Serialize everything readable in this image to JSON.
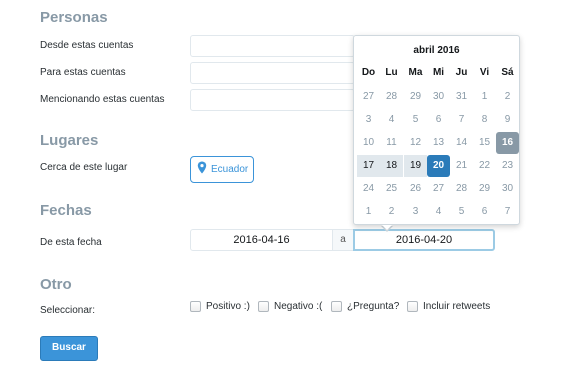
{
  "sections": {
    "personas": "Personas",
    "lugares": "Lugares",
    "fechas": "Fechas",
    "otro": "Otro"
  },
  "personas": {
    "from_label": "Desde estas cuentas",
    "to_label": "Para estas cuentas",
    "mention_label": "Mencionando estas cuentas"
  },
  "lugares": {
    "near_label": "Cerca de este lugar",
    "place_value": "Ecuador"
  },
  "fechas": {
    "date_label": "De esta fecha",
    "from_date": "2016-04-16",
    "separator": "a",
    "to_date": "2016-04-20"
  },
  "otro": {
    "select_label": "Seleccionar:",
    "options": [
      "Positivo :)",
      "Negativo :(",
      "¿Pregunta?",
      "Incluir retweets"
    ]
  },
  "search_button": "Buscar",
  "datepicker": {
    "title": "abril 2016",
    "weekdays": [
      "Do",
      "Lu",
      "Ma",
      "Mi",
      "Ju",
      "Vi",
      "Sá"
    ],
    "weeks": [
      [
        "27",
        "28",
        "29",
        "30",
        "31",
        "1",
        "2"
      ],
      [
        "3",
        "4",
        "5",
        "6",
        "7",
        "8",
        "9"
      ],
      [
        "10",
        "11",
        "12",
        "13",
        "14",
        "15",
        "16"
      ],
      [
        "17",
        "18",
        "19",
        "20",
        "21",
        "22",
        "23"
      ],
      [
        "24",
        "25",
        "26",
        "27",
        "28",
        "29",
        "30"
      ],
      [
        "1",
        "2",
        "3",
        "4",
        "5",
        "6",
        "7"
      ]
    ],
    "range_start": "16",
    "range_end": "20",
    "colors": {
      "range_start": "#8899a6",
      "range_end": "#2b7bb9",
      "range": "#e1e8ed",
      "accent": "#3b94d9"
    }
  }
}
